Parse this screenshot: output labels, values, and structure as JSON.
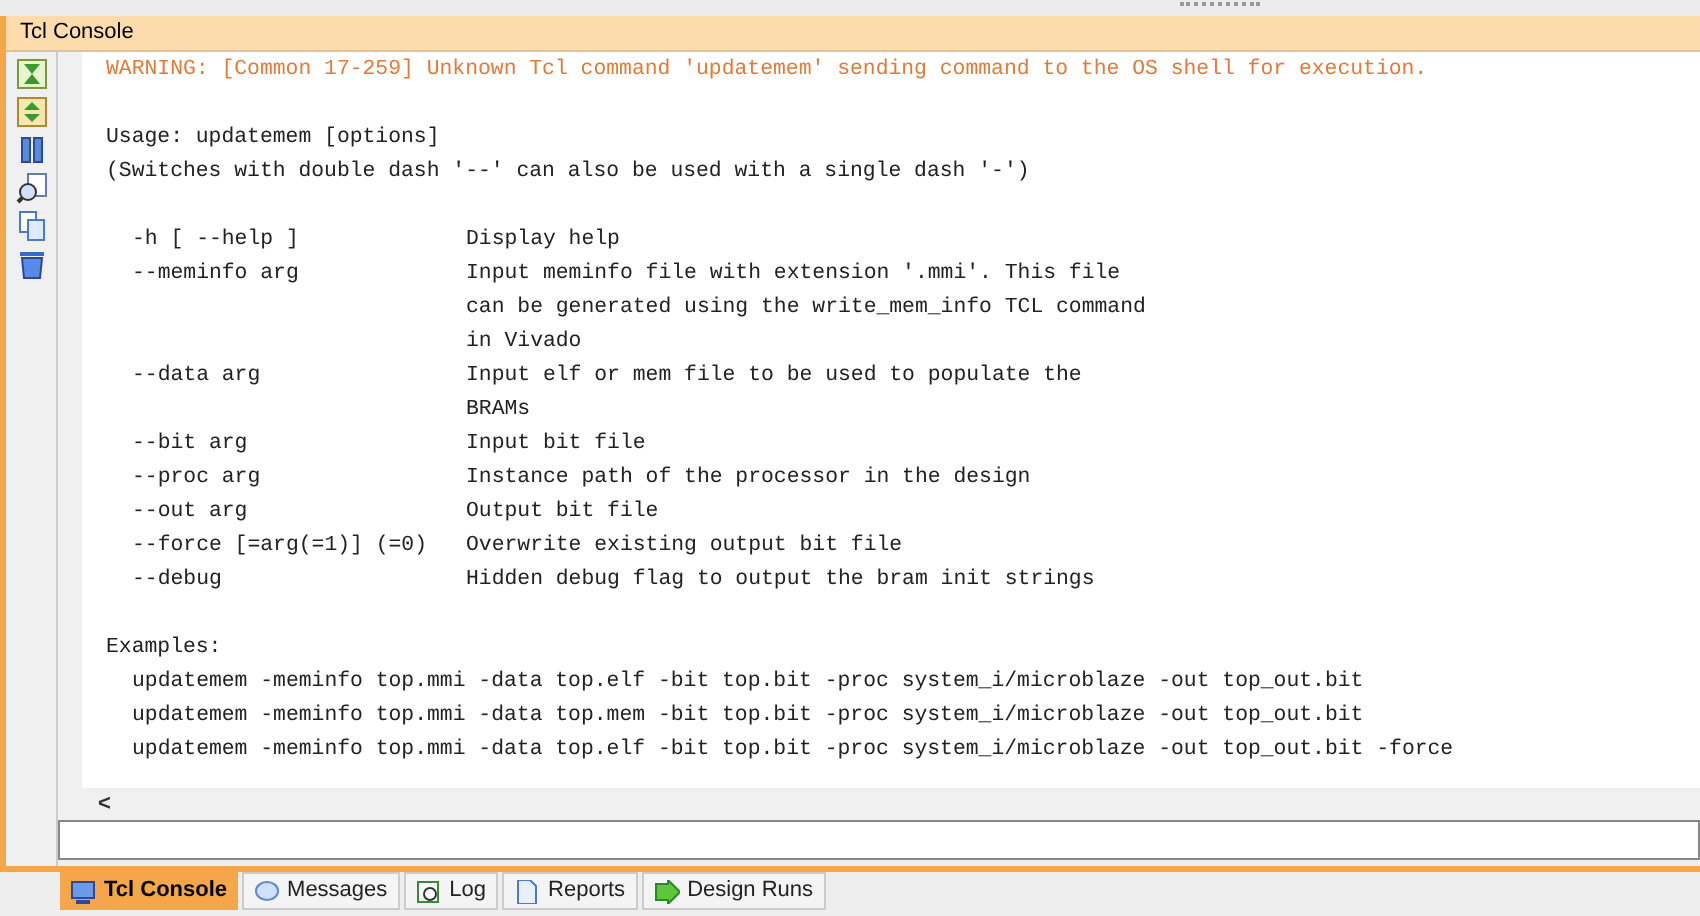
{
  "panel": {
    "title": "Tcl Console"
  },
  "console": {
    "blocks": [
      {
        "kind": "warning",
        "lines": [
          "WARNING: [Common 17-259] Unknown Tcl command 'updatemem' sending command to the OS shell for execution."
        ]
      },
      {
        "kind": "text",
        "lines": [
          "Usage: updatemem [options]",
          "(Switches with double dash '--' can also be used with a single dash '-')"
        ]
      },
      {
        "kind": "options",
        "rows": [
          {
            "option": "-h [ --help ]",
            "description": [
              "Display help"
            ]
          },
          {
            "option": "--meminfo arg",
            "description": [
              "Input meminfo file with extension '.mmi'. This file",
              "can be generated using the write_mem_info TCL command",
              "in Vivado"
            ]
          },
          {
            "option": "--data arg",
            "description": [
              "Input elf or mem file to be used to populate the",
              "BRAMs"
            ]
          },
          {
            "option": "--bit arg",
            "description": [
              "Input bit file"
            ]
          },
          {
            "option": "--proc arg",
            "description": [
              "Instance path of the processor in the design"
            ]
          },
          {
            "option": "--out arg",
            "description": [
              "Output bit file"
            ]
          },
          {
            "option": "--force [=arg(=1)] (=0)",
            "description": [
              "Overwrite existing output bit file"
            ]
          },
          {
            "option": "--debug",
            "description": [
              "Hidden debug flag to output the bram init strings"
            ]
          }
        ]
      },
      {
        "kind": "examples",
        "title": "Examples:",
        "lines": [
          "updatemem -meminfo top.mmi -data top.elf -bit top.bit -proc system_i/microblaze -out top_out.bit",
          "updatemem -meminfo top.mmi -data top.mem -bit top.bit -proc system_i/microblaze -out top_out.bit",
          "updatemem -meminfo top.mmi -data top.elf -bit top.bit -proc system_i/microblaze -out top_out.bit -force"
        ]
      }
    ]
  },
  "scroll_left": "<",
  "tabs": [
    {
      "label": "Tcl Console",
      "kind": "console",
      "selected": true
    },
    {
      "label": "Messages",
      "kind": "messages",
      "selected": false
    },
    {
      "label": "Log",
      "kind": "log",
      "selected": false
    },
    {
      "label": "Reports",
      "kind": "reports",
      "selected": false
    },
    {
      "label": "Design Runs",
      "kind": "runs",
      "selected": false
    }
  ]
}
